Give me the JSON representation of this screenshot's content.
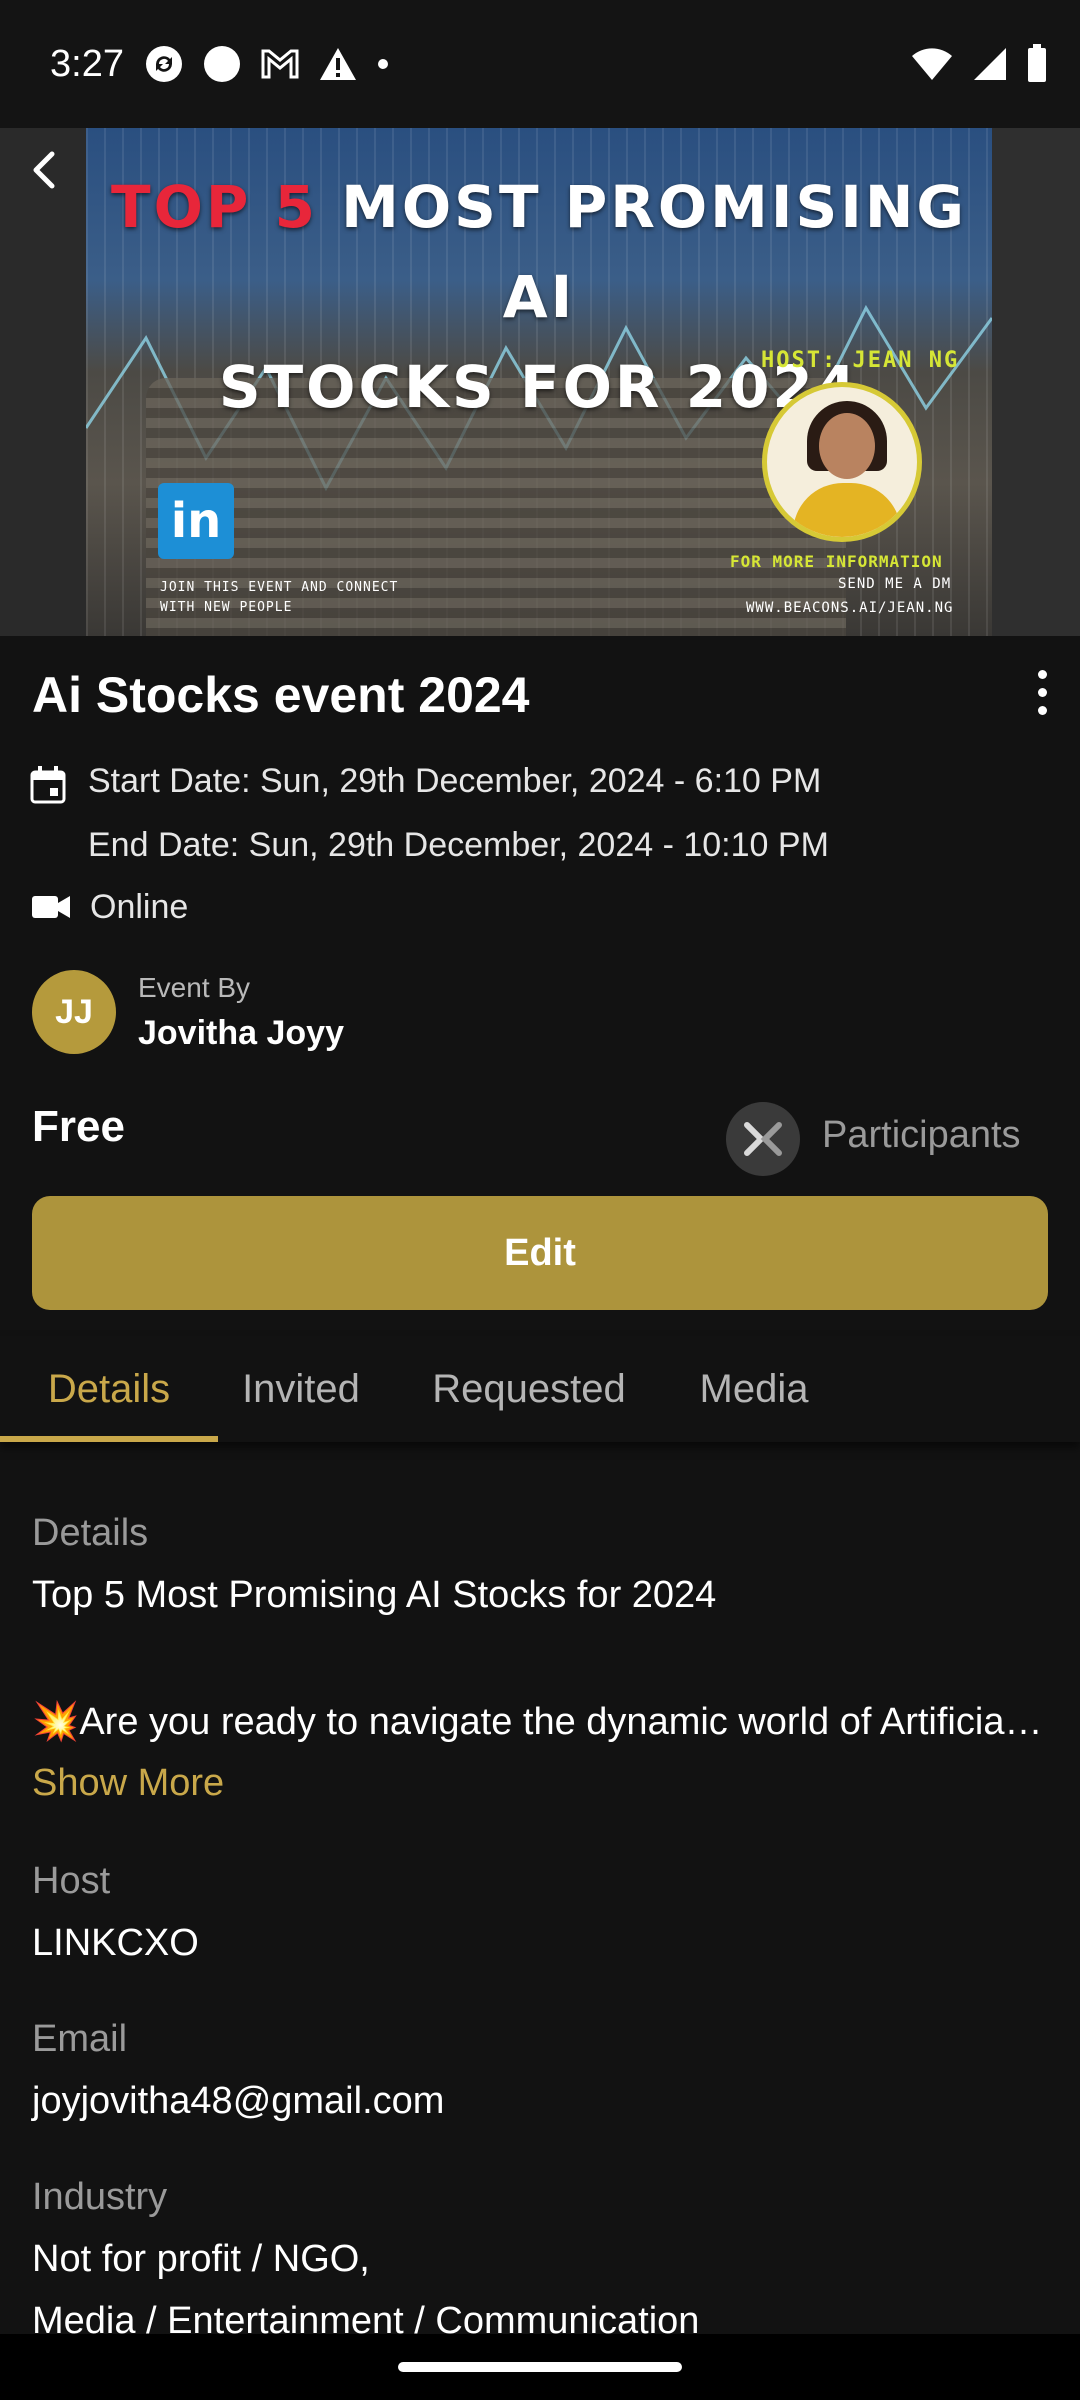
{
  "status_bar": {
    "time": "3:27"
  },
  "banner": {
    "title_line1_red": "TOP 5",
    "title_line1_rest": " MOST PROMISING AI",
    "title_line2": "STOCKS FOR 2024",
    "host_text": "HOST: JEAN NG",
    "linkedin_text": "in",
    "join_text": "JOIN THIS EVENT AND CONNECT WITH NEW PEOPLE",
    "more_info_text": "FOR MORE INFORMATION",
    "dm_text": "SEND ME A DM",
    "url_text": "WWW.BEACONS.AI/JEAN.NG"
  },
  "event": {
    "title": "Ai Stocks event 2024",
    "start_date": "Start Date: Sun, 29th December, 2024 - 6:10 PM",
    "end_date": "End Date: Sun, 29th December, 2024 - 10:10 PM",
    "location": "Online",
    "avatar_initials": "JJ",
    "event_by_label": "Event By",
    "organizer": "Jovitha Joyy",
    "price": "Free",
    "participants_label": "Participants",
    "edit_label": "Edit"
  },
  "tabs": [
    "Details",
    "Invited",
    "Requested",
    "Media"
  ],
  "details": {
    "section_label": "Details",
    "line1": "Top 5 Most Promising AI Stocks for 2024",
    "line2": "💥Are you ready to navigate the dynamic world of Artificial Intelligence",
    "show_more": "Show More",
    "host_label": "Host",
    "host_value": "LINKCXO",
    "email_label": "Email",
    "email_value": "joyjovitha48@gmail.com",
    "industry_label": "Industry",
    "industry_value_1": "Not for profit / NGO,",
    "industry_value_2": "Media / Entertainment / Communication"
  },
  "colors": {
    "accent": "#c9a84a",
    "edit_button": "#ad943c",
    "background": "#121212"
  }
}
